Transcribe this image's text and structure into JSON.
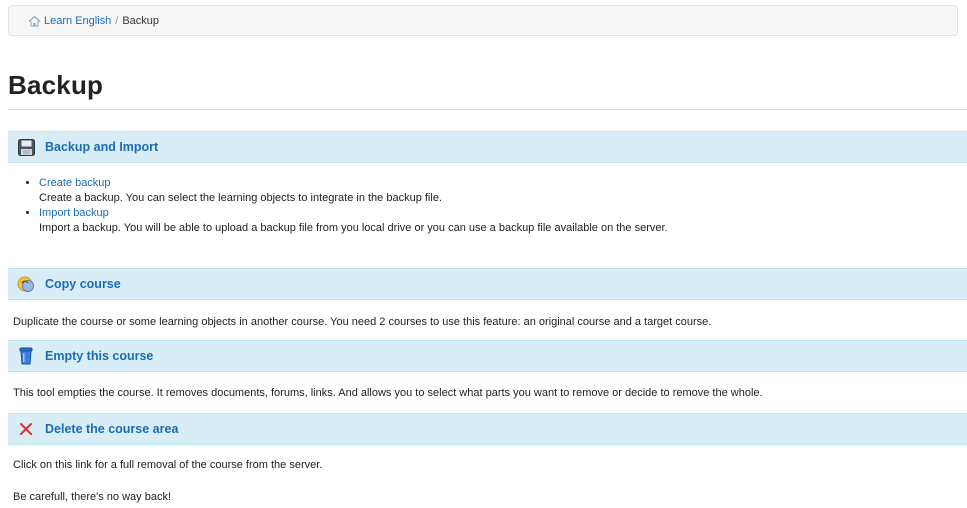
{
  "breadcrumb": {
    "home_label": "Learn English",
    "separator": "/",
    "current": "Backup"
  },
  "page": {
    "title": "Backup"
  },
  "sections": {
    "backup_import": {
      "title": "Backup and Import",
      "icon": "floppy-disk-icon",
      "items": [
        {
          "label": "Create backup",
          "description": "Create a backup. You can select the learning objects to integrate in the backup file."
        },
        {
          "label": "Import backup",
          "description": "Import a backup. You will be able to upload a backup file from you local drive or you can use a backup file available on the server."
        }
      ]
    },
    "copy_course": {
      "title": "Copy course",
      "icon": "copy-course-icon",
      "description": "Duplicate the course or some learning objects in another course. You need 2 courses to use this feature: an original course and a target course."
    },
    "empty_course": {
      "title": "Empty this course",
      "icon": "recycle-bin-icon",
      "description": "This tool empties the course. It removes documents, forums, links. And allows you to select what parts you want to remove or decide to remove the whole."
    },
    "delete_course": {
      "title": "Delete the course area",
      "icon": "delete-x-icon",
      "description": "Click on this link for a full removal of the course from the server.",
      "warning": "Be carefull, there's no way back!"
    }
  },
  "colors": {
    "link": "#1a6db5",
    "section_bg": "#d9edf7",
    "section_border": "#bce8f1",
    "delete_red": "#e03030"
  }
}
